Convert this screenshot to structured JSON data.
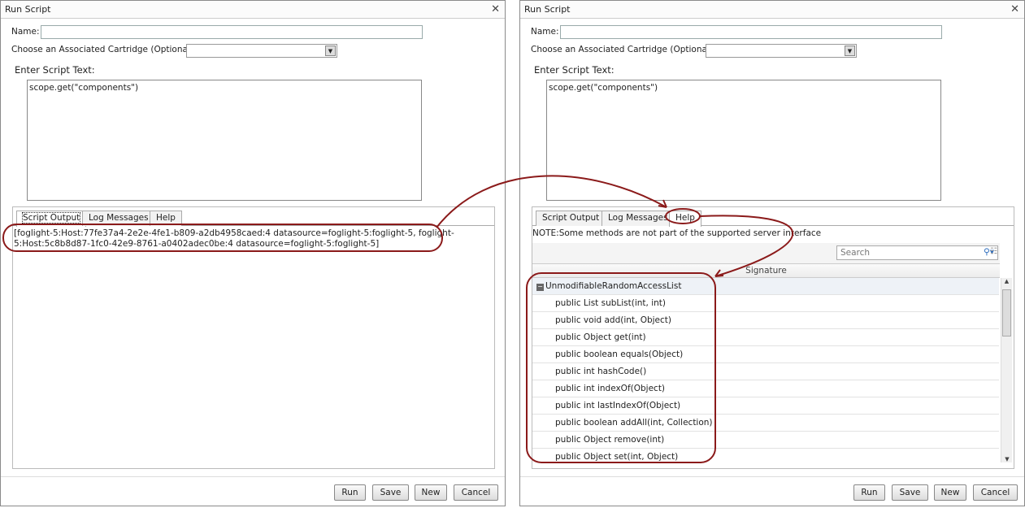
{
  "dialog": {
    "title": "Run Script",
    "name_label": "Name:",
    "name_value": "",
    "cartridge_label": "Choose an Associated Cartridge (Optional):",
    "cartridge_value": "",
    "script_label": "Enter Script Text:",
    "script_text": "scope.get(\"components\")"
  },
  "tabs": [
    "Script Output",
    "Log Messages",
    "Help"
  ],
  "buttons": {
    "run": "Run",
    "save": "Save",
    "new": "New",
    "cancel": "Cancel"
  },
  "left": {
    "active_tab": "Script Output",
    "output_line1": "[foglight-5:Host:77fe37a4-2e2e-4fe1-b809-a2db4958caed:4 datasource=foglight-5:foglight-5, foglight-",
    "output_line2": "5:Host:5c8b8d87-1fc0-42e9-8761-a0402adec0be:4 datasource=foglight-5:foglight-5]"
  },
  "right": {
    "active_tab": "Help",
    "note": "NOTE:Some methods are not part of the supported server interface",
    "search_placeholder": "Search",
    "column": "Signature",
    "group": "UnmodifiableRandomAccessList",
    "methods": [
      "public List subList(int, int)",
      "public void add(int, Object)",
      "public Object get(int)",
      "public boolean equals(Object)",
      "public int hashCode()",
      "public int indexOf(Object)",
      "public int lastIndexOf(Object)",
      "public boolean addAll(int, Collection)",
      "public Object remove(int)",
      "public Object set(int, Object)"
    ]
  },
  "annotation_color": "#8b1a1a"
}
